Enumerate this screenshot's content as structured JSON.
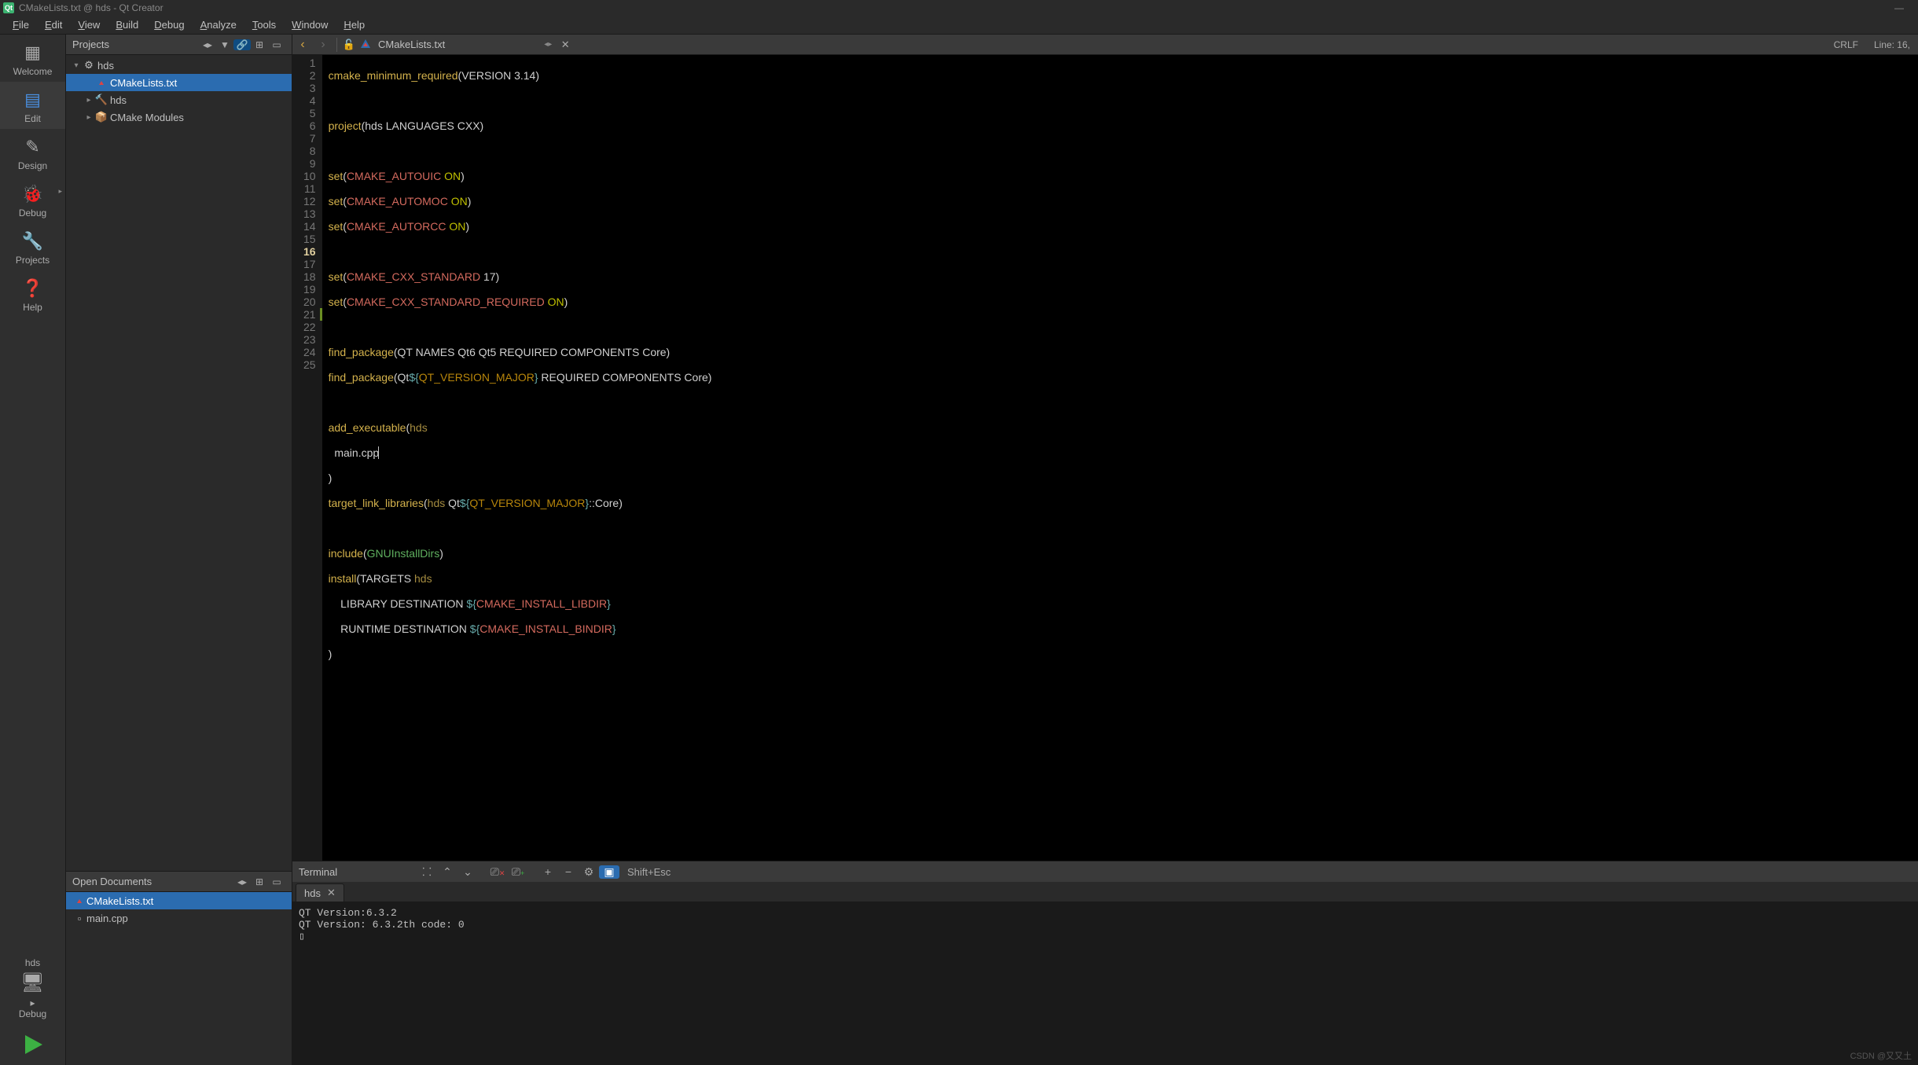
{
  "window": {
    "title": "CMakeLists.txt @ hds - Qt Creator"
  },
  "menu": [
    "File",
    "Edit",
    "View",
    "Build",
    "Debug",
    "Analyze",
    "Tools",
    "Window",
    "Help"
  ],
  "modes": {
    "welcome": "Welcome",
    "edit": "Edit",
    "design": "Design",
    "debug": "Debug",
    "projects": "Projects",
    "help": "Help"
  },
  "target": {
    "kit": "hds",
    "config": "Debug"
  },
  "projects_panel": {
    "title": "Projects",
    "tree": {
      "root": "hds",
      "file": "CMakeLists.txt",
      "sub1": "hds",
      "sub2": "CMake Modules"
    }
  },
  "open_docs": {
    "title": "Open Documents",
    "items": [
      "CMakeLists.txt",
      "main.cpp"
    ]
  },
  "editor": {
    "filename": "CMakeLists.txt",
    "status_encoding": "CRLF",
    "status_line": "Line: 16,",
    "current_line": 16,
    "code": {
      "l1a": "cmake_minimum_required",
      "l1b": "(VERSION 3.14)",
      "l3a": "project",
      "l3b": "(hds LANGUAGES CXX)",
      "l5a": "set",
      "l5b": "(",
      "l5c": "CMAKE_AUTOUIC",
      "l5d": " ",
      "l5e": "ON",
      "l5f": ")",
      "l6c": "CMAKE_AUTOMOC",
      "l7c": "CMAKE_AUTORCC",
      "l9a": "set",
      "l9b": "(",
      "l9c": "CMAKE_CXX_STANDARD",
      "l9d": " 17)",
      "l10c": "CMAKE_CXX_STANDARD_REQUIRED",
      "l10d": " ",
      "l10e": "ON",
      "l10f": ")",
      "l12a": "find_package",
      "l12b": "(QT NAMES Qt6 Qt5 REQUIRED COMPONENTS Core)",
      "l13a": "find_package",
      "l13b": "(Qt",
      "l13c": "${",
      "l13d": "QT_VERSION_MAJOR",
      "l13e": "}",
      "l13f": " REQUIRED COMPONENTS Core)",
      "l15a": "add_executable",
      "l15b": "(",
      "l15c": "hds",
      "l16": "  main.cpp",
      "l17": ")",
      "l18a": "target_link_libraries",
      "l18b": "(",
      "l18c": "hds",
      "l18d": " Qt",
      "l18e": "${",
      "l18f": "QT_VERSION_MAJOR",
      "l18g": "}",
      "l18h": "::Core)",
      "l20a": "include",
      "l20b": "(",
      "l20c": "GNUInstallDirs",
      "l20d": ")",
      "l21a": "install",
      "l21b": "(TARGETS ",
      "l21c": "hds",
      "l22a": "    LIBRARY DESTINATION ",
      "l22b": "${",
      "l22c": "CMAKE_INSTALL_LIBDIR",
      "l22d": "}",
      "l23a": "    RUNTIME DESTINATION ",
      "l23b": "${",
      "l23c": "CMAKE_INSTALL_BINDIR",
      "l23d": "}",
      "l24": ")"
    }
  },
  "terminal": {
    "title": "Terminal",
    "hint": "Shift+Esc",
    "tab": "hds",
    "output": "QT Version:6.3.2\nQT Version: 6.3.2th code: 0\n▯"
  },
  "watermark": "CSDN @又又土"
}
